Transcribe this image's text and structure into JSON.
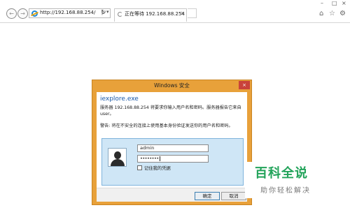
{
  "browser": {
    "address_url": "http://192.168.88.254/",
    "search_glyph": "ρ",
    "dropdown_glyph": "▾",
    "refresh_glyph": "↻",
    "tab_title": "正在等待 192.168.88.254",
    "tab_close": "×",
    "back_glyph": "←",
    "forward_glyph": "→",
    "minimize_glyph": "–",
    "maximize_glyph": "□",
    "close_glyph": "×",
    "home_glyph": "⌂",
    "favorites_glyph": "☆",
    "tools_glyph": "⚙"
  },
  "dialog": {
    "title": "Windows 安全",
    "close_glyph": "×",
    "app_name": "iexplore.exe",
    "server_message": "服务器 192.168.88.254 将要求你输入用户名和密码。服务器报告它来自 user。",
    "warning_message": "警告: 将在不安全的连接上使用基本身份验证发送你的用户名和密码。",
    "username": "admin",
    "password_mask": "••••••••",
    "remember_label": "记住我的凭据",
    "ok_label": "确定",
    "cancel_label": "取消",
    "accent_color": "#e8a13a"
  },
  "watermark": {
    "title": "百科全说",
    "subtitle": "助你轻松解决"
  }
}
